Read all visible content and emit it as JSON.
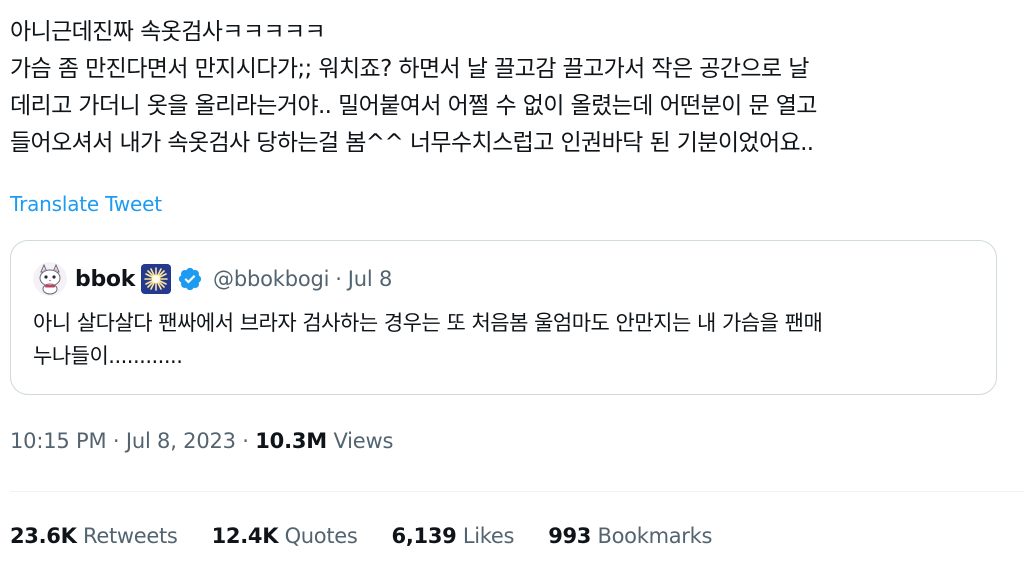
{
  "tweet": {
    "text_lines": [
      "아니근데진짜 속옷검사ㅋㅋㅋㅋㅋ",
      "가슴 좀 만진다면서 만지시다가;; 워치죠? 하면서 날 끌고감 끌고가서 작은 공간으로 날",
      "데리고 가더니 옷을 올리라는거야.. 밀어붙여서 어쩔 수 없이 올렸는데 어떤분이 문 열고",
      "들어오셔서 내가 속옷검사 당하는걸 봄^^ 너무수치스럽고 인권바닥 된 기분이었어요.."
    ],
    "translate_label": "Translate Tweet"
  },
  "quote": {
    "display_name": "bbok",
    "handle": "@bbokbogi",
    "separator": "·",
    "date": "Jul 8",
    "body_lines": [
      "아니 살다살다 팬싸에서 브라자 검사하는 경우는 또 처음봄 울엄마도 안만지는 내 가슴을 팬매",
      "누나들이............"
    ],
    "avatar_icon": "cat-avatar-icon",
    "badge_icon": "sparkle-emoji-icon",
    "verified_icon": "verified-badge-icon",
    "verified_color": "#1d9bf0"
  },
  "meta": {
    "time": "10:15 PM",
    "separator": "·",
    "date": "Jul 8, 2023",
    "views_count": "10.3M",
    "views_label": "Views"
  },
  "stats": [
    {
      "count": "23.6K",
      "label": "Retweets"
    },
    {
      "count": "12.4K",
      "label": "Quotes"
    },
    {
      "count": "6,139",
      "label": "Likes"
    },
    {
      "count": "993",
      "label": "Bookmarks"
    }
  ],
  "colors": {
    "text": "#0f1419",
    "secondary": "#536471",
    "link": "#1d9bf0",
    "border": "#cfd9de"
  }
}
